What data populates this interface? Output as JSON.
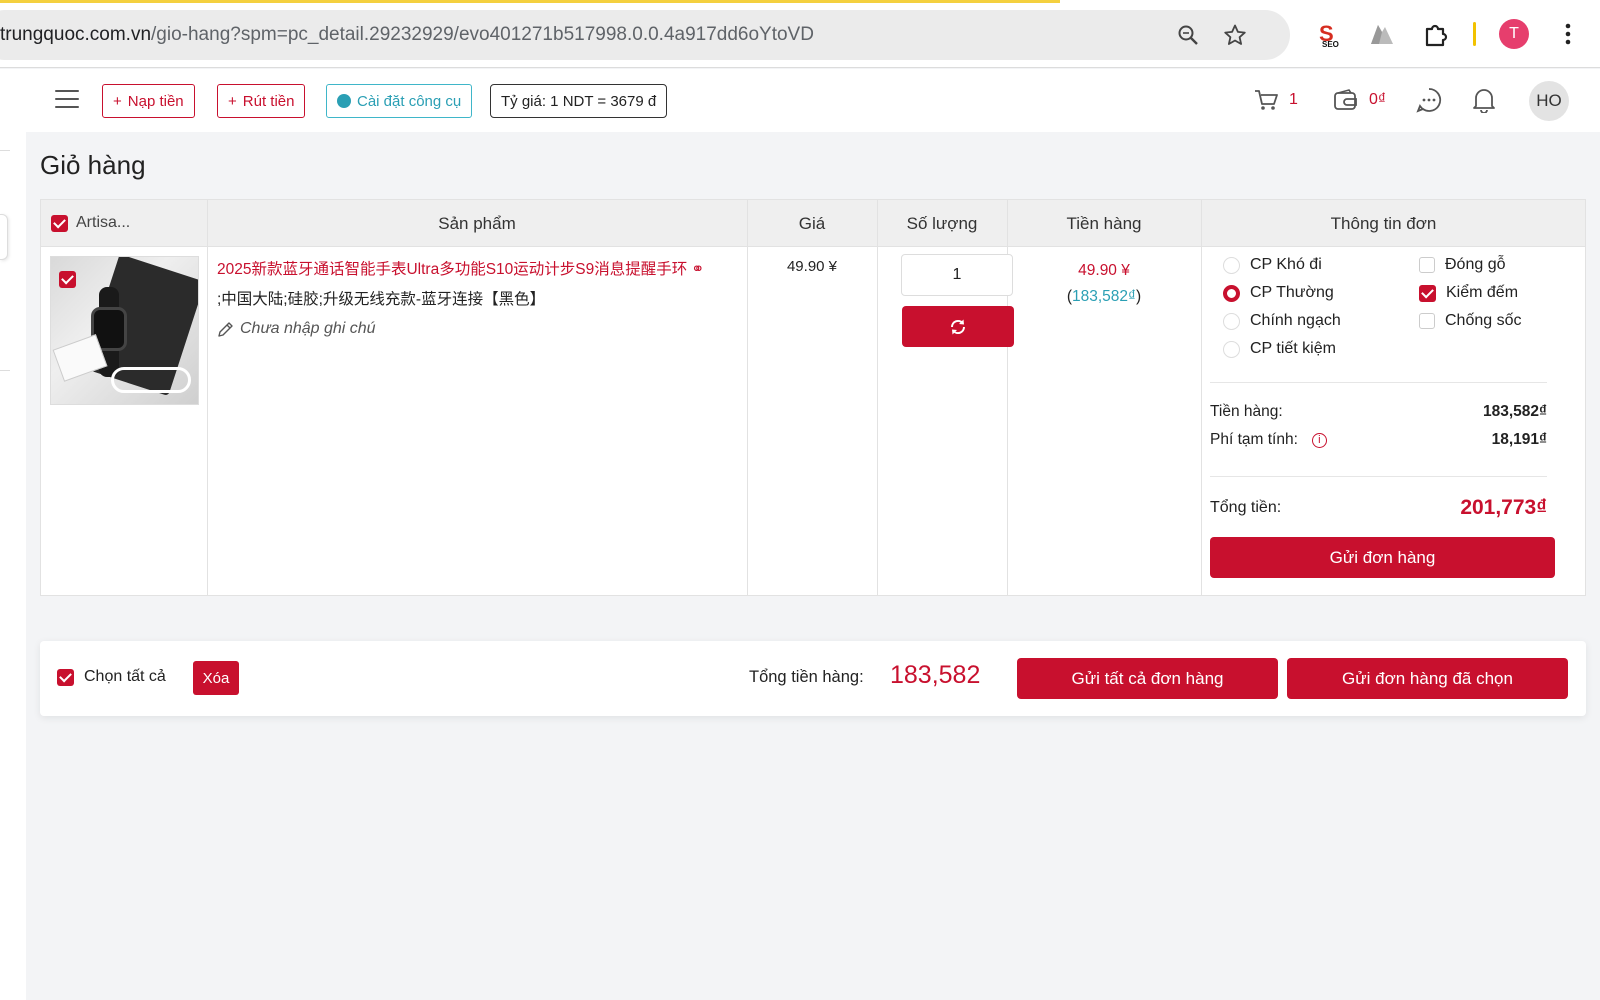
{
  "browser": {
    "url_domain": "trungquoc.com.vn",
    "url_path": "/gio-hang?spm=pc_detail.29232929/evo401271b517998.0.0.4a917dd6oYtoVD",
    "profile_initial": "T",
    "icons": [
      "zoom-icon",
      "star-icon",
      "seo-extension-icon",
      "ext-icon",
      "puzzle-icon",
      "menu-dots-icon"
    ]
  },
  "header": {
    "nap_tien": "Nạp tiền",
    "rut_tien": "Rút tiền",
    "cai_dat": "Cài đặt công cụ",
    "ty_gia": "Tỷ giá: 1 NDT = 3679 đ",
    "cart_count": "1",
    "wallet": "0₫",
    "avatar": "HO"
  },
  "page": {
    "title": "Giỏ hàng"
  },
  "table": {
    "shop_name": "Artisa...",
    "headers": {
      "product": "Sản phẩm",
      "price": "Giá",
      "quantity": "Số lượng",
      "amount": "Tiền hàng",
      "order_info": "Thông tin đơn"
    },
    "item": {
      "title": "2025新款蓝牙通话智能手表Ultra多功能S10运动计步S9消息提醒手环",
      "variant": ";中国大陆;硅胶;升级无线充款-蓝牙连接【黑色】",
      "note": "Chưa nhập ghi chú",
      "price": "49.90 ¥",
      "quantity": "1",
      "amount_cny": "49.90 ¥",
      "amount_vnd": "183,582₫"
    },
    "shipping_options": [
      {
        "label": "CP Khó đi",
        "selected": false
      },
      {
        "label": "CP Thường",
        "selected": true
      },
      {
        "label": "Chính ngạch",
        "selected": false
      },
      {
        "label": "CP tiết kiệm",
        "selected": false
      }
    ],
    "service_options": [
      {
        "label": "Đóng gỗ",
        "checked": false
      },
      {
        "label": "Kiểm đếm",
        "checked": true
      },
      {
        "label": "Chống sốc",
        "checked": false
      }
    ],
    "summary": {
      "tien_hang_label": "Tiền hàng:",
      "tien_hang_value": "183,582₫",
      "phi_label": "Phí tạm tính:",
      "phi_value": "18,191₫",
      "tong_label": "Tổng tiền:",
      "tong_value": "201,773₫",
      "send_label": "Gửi đơn hàng"
    }
  },
  "footer": {
    "select_all": "Chọn tất cả",
    "delete": "Xóa",
    "total_label": "Tổng tiền hàng:",
    "total_value": "183,582",
    "send_all": "Gửi tất cả đơn hàng",
    "send_selected": "Gửi đơn hàng đã chọn"
  },
  "colors": {
    "accent": "#c8102e",
    "teal": "#2a9fb4"
  }
}
